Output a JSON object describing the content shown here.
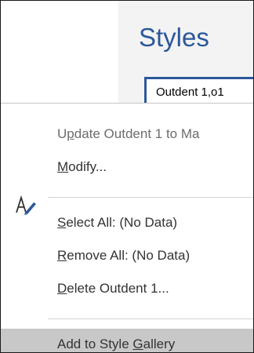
{
  "ribbon": {
    "title": "Styles",
    "current_style": "Outdent 1,o1"
  },
  "context_menu": {
    "items": [
      {
        "pre": "U",
        "key": "p",
        "post": "date Outdent 1 to Ma"
      },
      {
        "pre": "",
        "key": "M",
        "post": "odify..."
      },
      {
        "pre": "",
        "key": "S",
        "post": "elect All: (No Data)"
      },
      {
        "pre": "",
        "key": "R",
        "post": "emove All: (No Data)"
      },
      {
        "pre": "",
        "key": "D",
        "post": "elete Outdent 1..."
      },
      {
        "pre": "Add to Style ",
        "key": "G",
        "post": "allery"
      }
    ]
  },
  "icons": {
    "modify": "modify-style-icon"
  },
  "colors": {
    "accent": "#2b579a",
    "highlight": "#c8c8c8"
  }
}
